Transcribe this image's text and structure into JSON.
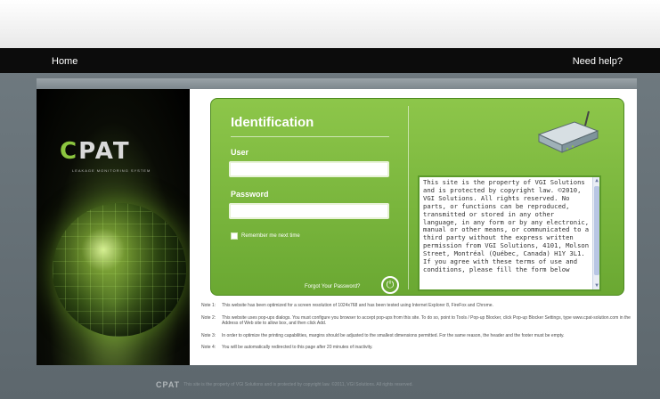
{
  "nav": {
    "home": "Home",
    "help": "Need help?"
  },
  "brand": {
    "logo_c": "C",
    "logo_rest": "PAT",
    "tagline": "LEAKAGE MONITORING SYSTEM"
  },
  "login": {
    "title": "Identification",
    "user_label": "User",
    "user_value": "",
    "password_label": "Password",
    "password_value": "",
    "remember_label": "Remember me next time",
    "remember_checked": false,
    "forgot_label": "Forgot Your Password?",
    "power_icon": "power-icon"
  },
  "legal": {
    "text": "This site is the property of VGI Solutions and is protected by copyright law. ©2010, VGI Solutions. All rights reserved. No parts, or functions can be reproduced, transmitted or stored in any other language, in any form or by any electronic, manual or other means, or communicated to a third party without the express written permission from VGI Solutions, 4101, Molson Street, Montréal (Québec, Canada) H1Y 3L1. If you agree with these terms of use and conditions, please fill the form below"
  },
  "notes": [
    {
      "label": "Note 1:",
      "text": "This website has been optimized for a screen resolution of 1024x768 and has been tested using Internet Explorer 8, FireFox and Chrome."
    },
    {
      "label": "Note 2:",
      "text": "This website uses pop-ups dialogs. You must configure you browser to accept pop-ups from this site. To do so, point to Tools / Pop-up Blocker, click Pop-up Blocker Settings, type www.cpat-solution.com in the Address of Web site to allow box, and then click Add."
    },
    {
      "label": "Note 3:",
      "text": "In order to optimize the printing capabilities, margins should be adjusted to the smallest dimensions permitted. For the same reason, the header and the footer must be empty."
    },
    {
      "label": "Note 4:",
      "text": "You will be automatically redirected to this page after 20 minutes of inactivity."
    }
  ],
  "footer": {
    "logo": "CPAT",
    "text": "This site is the property of VGI Solutions and is protected by copyright law. ©2011, VGI Solutions. All rights reserved."
  },
  "colors": {
    "accent_green": "#7ab63e",
    "nav_bg": "#0c0c0c"
  }
}
